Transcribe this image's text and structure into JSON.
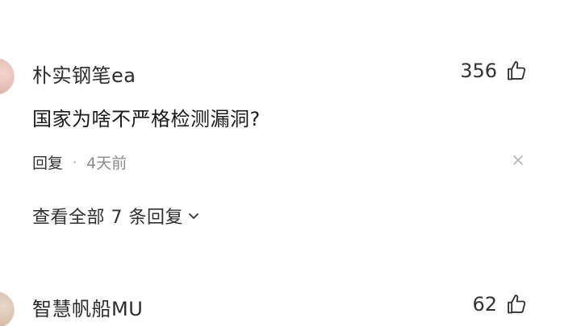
{
  "comments": [
    {
      "username": "朴实钢笔ea",
      "likes": "356",
      "text": "国家为啥不严格检测漏洞?",
      "reply_label": "回复",
      "separator": "·",
      "time": "4天前",
      "view_replies": "查看全部 7 条回复",
      "icons": {
        "like": "thumbs-up-icon",
        "dismiss": "close-icon",
        "expand": "chevron-down-icon"
      }
    },
    {
      "username": "智慧帆船MU",
      "likes": "62",
      "icons": {
        "like": "thumbs-up-icon"
      }
    }
  ]
}
